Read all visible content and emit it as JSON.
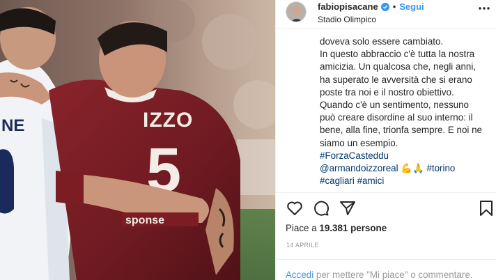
{
  "post": {
    "username": "fabiopisacane",
    "follow_label": "Segui",
    "dot": "•",
    "location": "Stadio Olimpico",
    "jersey_name": "IZZO",
    "jersey_number": "5",
    "left_jersey_text": "NE"
  },
  "caption": {
    "lines": [
      "doveva solo essere cambiato.",
      "In questo abbraccio c'è tutta la nostra",
      "amicizia. Un qualcosa che, negli anni,",
      "ha superato le avversità che si erano",
      "poste tra noi e il nostro obiettivo.",
      "Quando c'è un sentimento, nessuno",
      "può creare disordine al suo interno: il",
      "bene, alla fine, trionfa sempre. E noi ne",
      "siamo un esempio."
    ],
    "hashtag_forza": "#ForzaCasteddu",
    "mention": "@armandoizzoreal",
    "emoji_1": "💪",
    "emoji_2": "🙏",
    "hashtag_torino": "#torino",
    "hashtag_cagliari": "#cagliari",
    "hashtag_amici": "#amici"
  },
  "engagement": {
    "likes_prefix": "Piace a ",
    "likes_count": "19.381",
    "likes_suffix": " persone",
    "date": "14 APRILE"
  },
  "comment_bar": {
    "login_link": "Accedi",
    "text": " per mettere \"Mi piace\" o commentare."
  },
  "icons": {
    "verified": "verified-badge-icon",
    "more": "more-options-icon",
    "like": "heart-icon",
    "comment": "comment-icon",
    "share": "share-icon",
    "save": "bookmark-icon"
  },
  "colors": {
    "link_blue": "#3897f0",
    "hashtag": "#003569",
    "torino_maroon": "#7b1d23",
    "text": "#262626",
    "muted": "#999999"
  }
}
